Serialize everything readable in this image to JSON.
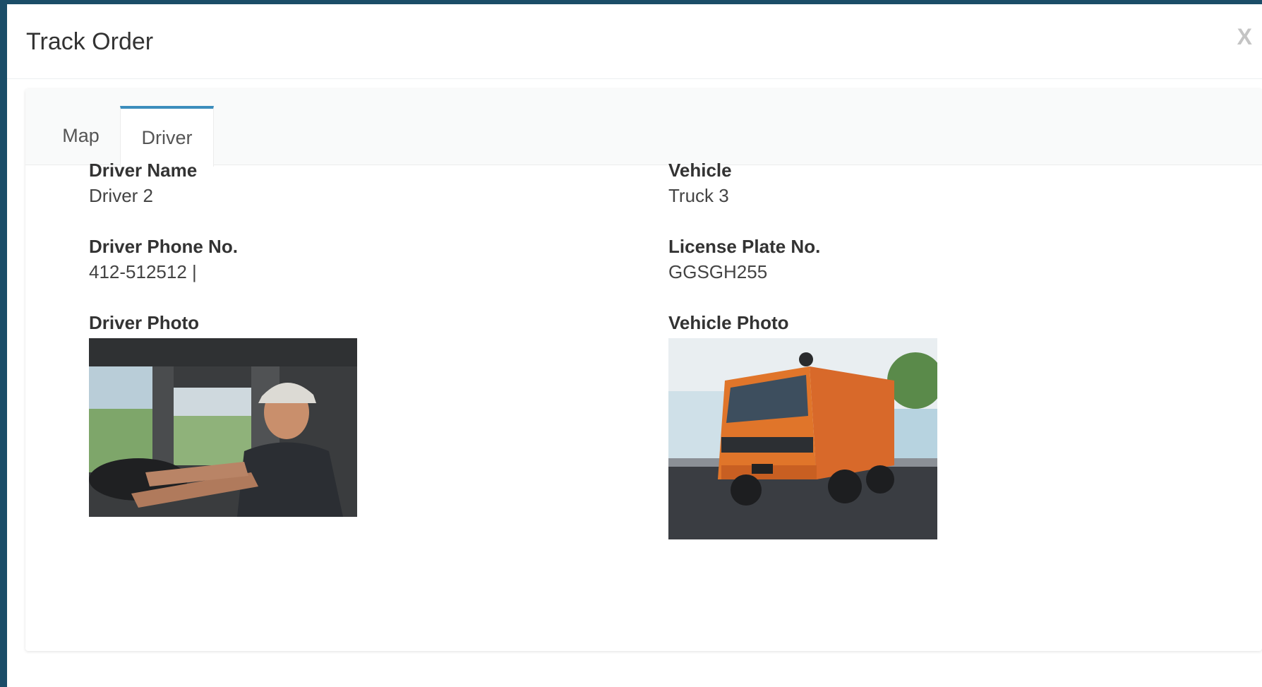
{
  "modal": {
    "title": "Track Order",
    "close_label": "X"
  },
  "tabs": [
    {
      "label": "Map",
      "active": false
    },
    {
      "label": "Driver",
      "active": true
    }
  ],
  "driver": {
    "name_label": "Driver Name",
    "name_value": "Driver 2",
    "phone_label": "Driver Phone No.",
    "phone_value": "412-512512 |",
    "photo_label": "Driver Photo"
  },
  "vehicle": {
    "name_label": "Vehicle",
    "name_value": "Truck 3",
    "plate_label": "License Plate No.",
    "plate_value": "GGSGH255",
    "photo_label": "Vehicle Photo"
  },
  "colors": {
    "backdrop": "#1b4d68",
    "active_tab_accent": "#3c8dbc",
    "truck_body": "#e0752a"
  }
}
